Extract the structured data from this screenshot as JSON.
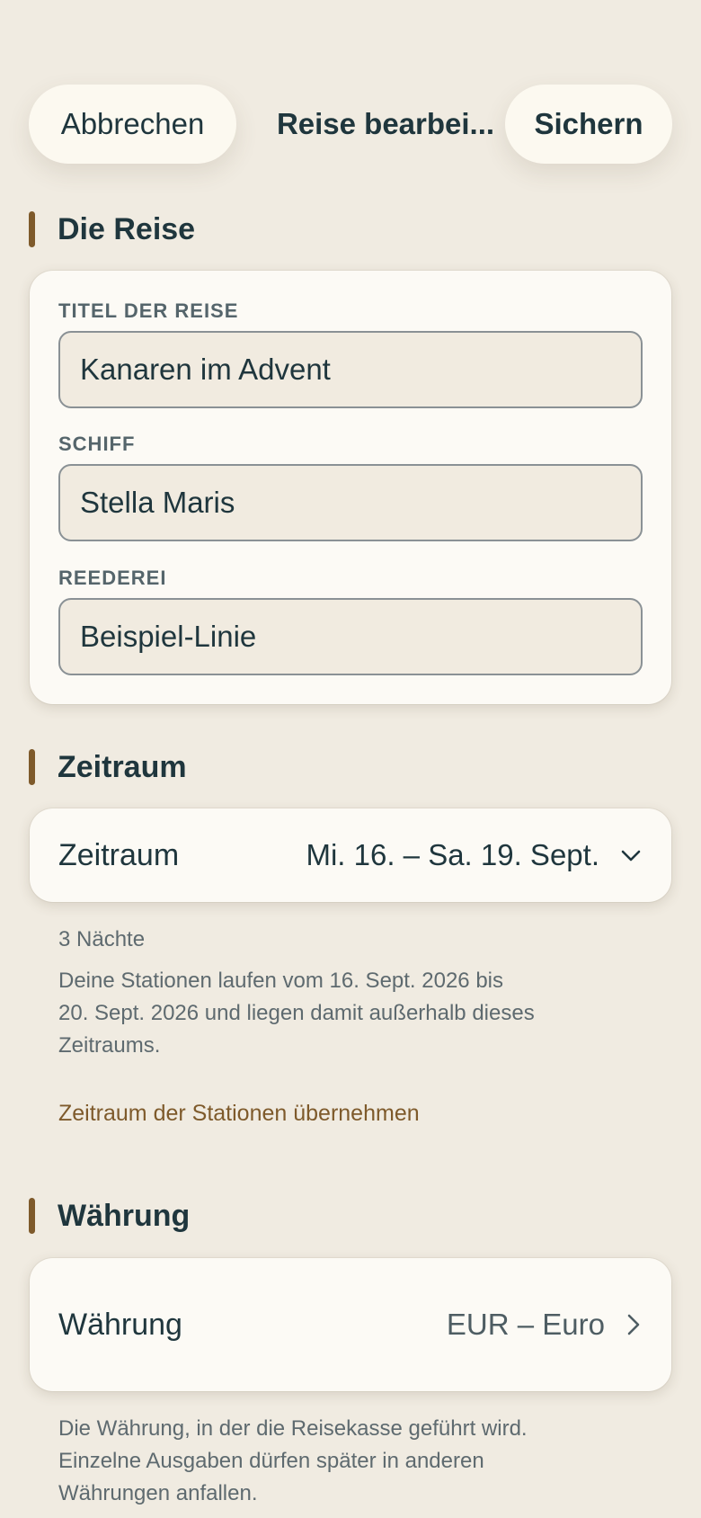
{
  "header": {
    "cancel_label": "Abbrechen",
    "title": "Reise bearbei...",
    "save_label": "Sichern"
  },
  "sections": {
    "trip": {
      "heading": "Die Reise",
      "title_label": "TITEL DER REISE",
      "title_value": "Kanaren im Advent",
      "ship_label": "SCHIFF",
      "ship_value": "Stella Maris",
      "line_label": "REEDEREI",
      "line_value": "Beispiel-Linie"
    },
    "period": {
      "heading": "Zeitraum",
      "row_label": "Zeitraum",
      "row_value": "Mi. 16. – Sa. 19. Sept.",
      "nights": "3 Nächte",
      "warning_line1": "Deine Stationen laufen vom 16. Sept. 2026 bis",
      "warning_line2": "20. Sept. 2026 und liegen damit außerhalb dieses",
      "warning_line3": "Zeitraums.",
      "adopt_link": "Zeitraum der Stationen übernehmen"
    },
    "currency": {
      "heading": "Währung",
      "row_label": "Währung",
      "row_value": "EUR – Euro",
      "note_line1": "Die Währung, in der die Reisekasse geführt wird.",
      "note_line2": "Einzelne Ausgaben dürfen später in anderen",
      "note_line3": "Währungen anfallen."
    }
  },
  "colors": {
    "background": "#f0ebe1",
    "card": "#fcfaf5",
    "accent": "#7e5a2b",
    "text": "#1f363d"
  },
  "icons": {
    "period_row": "chevron-down-icon",
    "currency_row": "chevron-right-icon"
  }
}
